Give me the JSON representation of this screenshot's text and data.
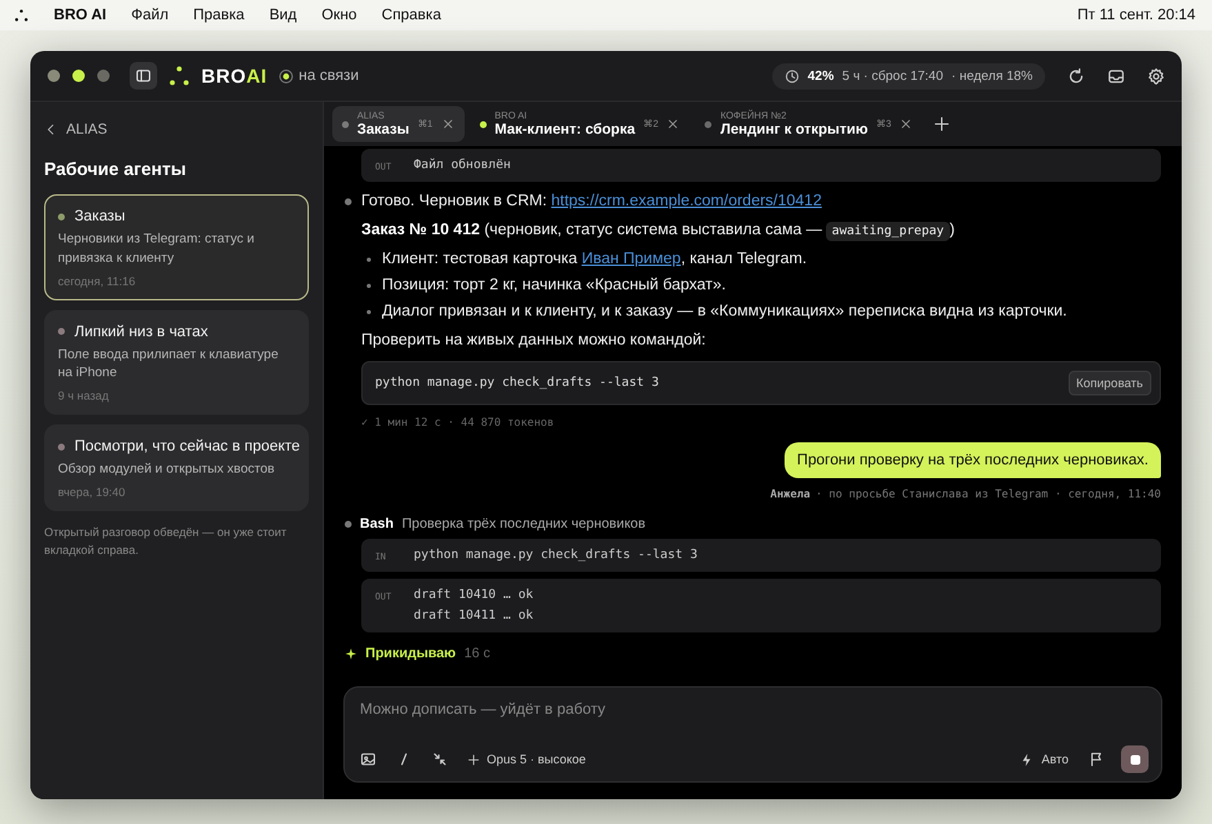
{
  "menubar": {
    "app_name": "BRO AI",
    "menus": [
      "Файл",
      "Правка",
      "Вид",
      "Окно",
      "Справка"
    ],
    "clock": "Пт 11 сент. 20:14"
  },
  "titlebar": {
    "brand": {
      "main": "BRO",
      "accent": "AI"
    },
    "connection": {
      "label": "на связи",
      "online": true
    },
    "usage": {
      "percent": "42%",
      "session": "5 ч · сброс 17:40",
      "week": "· неделя 18%"
    }
  },
  "sidebar": {
    "back_label": "ALIAS",
    "heading": "Рабочие агенты",
    "agents": [
      {
        "title": "Заказы",
        "description": "Черновики из Telegram: статус и привязка к клиенту",
        "time": "сегодня, 11:16",
        "selected": true,
        "color": "#8d9c6a"
      },
      {
        "title": "Липкий низ в чатах",
        "description": "Поле ввода прилипает к клавиатуре на iPhone",
        "time": "9 ч назад",
        "selected": false,
        "color": "#8c7b7e"
      },
      {
        "title": "Посмотри, что сейчас в проекте",
        "description": "Обзор модулей и открытых хвостов",
        "time": "вчера, 19:40",
        "selected": false,
        "color": "#8c7b7e"
      }
    ],
    "footnote": "Открытый разговор обведён — он уже стоит вкладкой справа."
  },
  "tabs": [
    {
      "project": "ALIAS",
      "title": "Заказы",
      "shortcut": "⌘1",
      "selected": true,
      "color": "#7a7a7a"
    },
    {
      "project": "BRO AI",
      "title": "Мак-клиент: сборка",
      "shortcut": "⌘2",
      "selected": false,
      "color": "#c8f04a"
    },
    {
      "project": "КОФЕЙНЯ №2",
      "title": "Лендинг к открытию",
      "shortcut": "⌘3",
      "selected": false,
      "color": "#6a6a6a"
    }
  ],
  "chat": [
    {
      "kind": "tool_output",
      "label": "OUT",
      "lines": [
        "Файл обновлён"
      ]
    },
    {
      "kind": "assistant",
      "blocks": [
        {
          "kind": "paragraph",
          "parts": [
            {
              "kind": "text",
              "text": "Готово. Черновик в CRM: "
            },
            {
              "kind": "link",
              "text": "https://crm.example.com/orders/10412"
            }
          ]
        },
        {
          "kind": "paragraph",
          "parts": [
            {
              "kind": "text",
              "text": "**Заказ № 10 412** (черновик, статус система выставила сама — "
            },
            {
              "kind": "code",
              "text": "awaiting_prepay"
            },
            {
              "kind": "text",
              "text": ")"
            }
          ]
        },
        {
          "kind": "bullets",
          "items": [
            [
              {
                "kind": "text",
                "text": "Клиент: тестовая карточка "
              },
              {
                "kind": "link",
                "text": "Иван Пример"
              },
              {
                "kind": "text",
                "text": ", канал Telegram."
              }
            ],
            [
              {
                "kind": "text",
                "text": "Позиция: торт 2 кг, начинка «Красный бархат»."
              }
            ],
            [
              {
                "kind": "text",
                "text": "Диалог привязан и к клиенту, и к заказу — в «Коммуникациях» переписка видна из карточки."
              }
            ]
          ]
        },
        {
          "kind": "paragraph",
          "parts": [
            {
              "kind": "text",
              "text": "Проверить на живых данных можно командой:"
            }
          ]
        },
        {
          "kind": "code",
          "text": "python manage.py check_drafts --last 3",
          "button": "Копировать"
        }
      ]
    },
    {
      "kind": "stats",
      "text": "✓ 1 мин 12 с · 44 870 токенов"
    },
    {
      "kind": "user",
      "text": "Прогони проверку на трёх последних черновиках.",
      "author": "Анжела",
      "meta": "· по просьбе Станислава из Telegram · сегодня, 11:40"
    },
    {
      "kind": "tool",
      "name": "Bash",
      "description": "Проверка трёх последних черновиков",
      "input_label": "IN",
      "input": "python manage.py check_drafts --last 3",
      "output_label": "OUT",
      "output": [
        "draft 10410 … ok",
        "draft 10411 … ok"
      ]
    },
    {
      "kind": "thinking",
      "label": "Прикидываю",
      "elapsed": "16 с"
    }
  ],
  "composer": {
    "placeholder": "Можно дописать — уйдёт в работу",
    "model": "Opus 5 · высокое",
    "mode": "Авто"
  }
}
